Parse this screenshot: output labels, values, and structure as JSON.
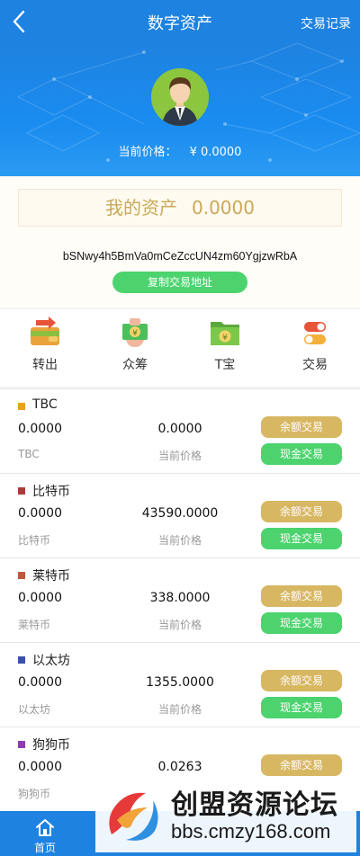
{
  "header": {
    "title": "数字资产",
    "right_link": "交易记录"
  },
  "hero": {
    "price_label": "当前价格：",
    "price_value": "¥ 0.0000"
  },
  "assets": {
    "label": "我的资产",
    "value": "0.0000",
    "address": "bSNwy4h5BmVa0mCeZccUN4zm60YgjzwRbA",
    "copy_button": "复制交易地址"
  },
  "menu": [
    {
      "label": "转出",
      "icon": "wallet-transfer-icon"
    },
    {
      "label": "众筹",
      "icon": "crowdfunding-money-icon"
    },
    {
      "label": "T宝",
      "icon": "folder-yen-icon"
    },
    {
      "label": "交易",
      "icon": "toggle-switch-icon"
    }
  ],
  "coin_labels": {
    "price_label": "当前价格",
    "balance_trade": "余额交易",
    "cash_trade": "现金交易"
  },
  "coins": [
    {
      "name": "TBC",
      "balance": "0.0000",
      "price": "0.0000",
      "symbol": "TBC",
      "color": "#e8a21c"
    },
    {
      "name": "比特币",
      "balance": "0.0000",
      "price": "43590.0000",
      "symbol": "比特币",
      "color": "#b03a3a"
    },
    {
      "name": "莱特币",
      "balance": "0.0000",
      "price": "338.0000",
      "symbol": "莱特币",
      "color": "#c0583a"
    },
    {
      "name": "以太坊",
      "balance": "0.0000",
      "price": "1355.0000",
      "symbol": "以太坊",
      "color": "#3a4fb0"
    },
    {
      "name": "狗狗币",
      "balance": "0.0000",
      "price": "0.0263",
      "symbol": "狗狗币",
      "color": "#8e3ab0"
    }
  ],
  "tabbar": [
    {
      "label": "首页",
      "icon": "home-icon"
    }
  ],
  "watermark": {
    "title": "创盟资源论坛",
    "url": "bbs.cmzy168.com"
  },
  "colors": {
    "primary": "#1e82e0",
    "gold": "#d8b763",
    "green": "#4cd36e"
  }
}
